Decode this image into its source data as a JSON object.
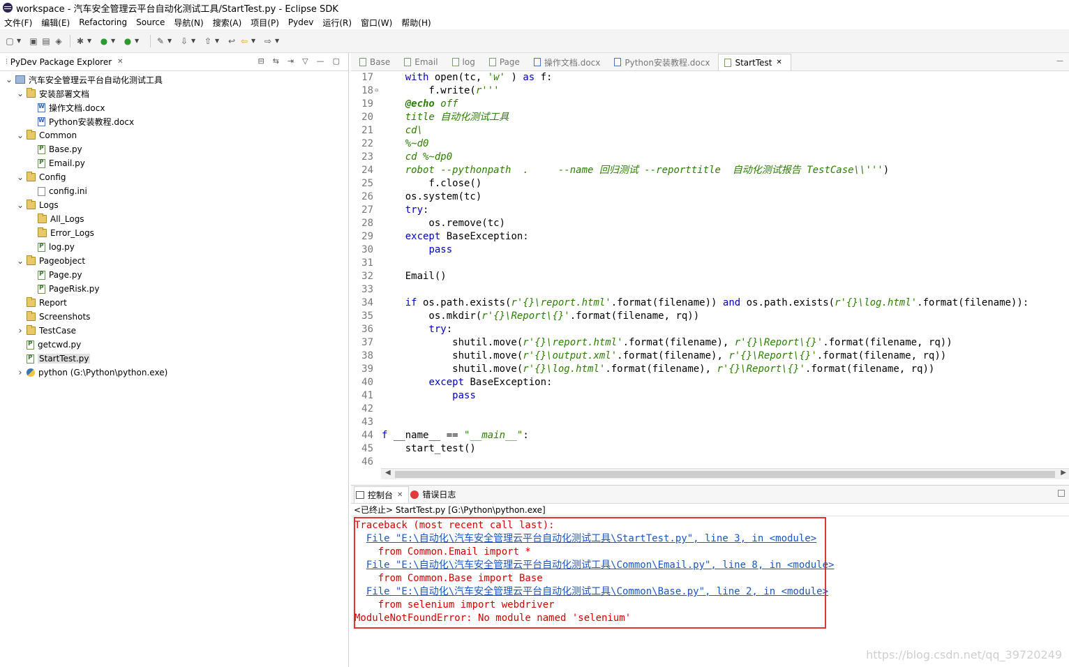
{
  "window": {
    "title": "workspace - 汽车安全管理云平台自动化测试工具/StartTest.py - Eclipse SDK"
  },
  "menu": [
    "文件(F)",
    "编辑(E)",
    "Refactoring",
    "Source",
    "导航(N)",
    "搜索(A)",
    "项目(P)",
    "Pydev",
    "运行(R)",
    "窗口(W)",
    "帮助(H)"
  ],
  "explorer": {
    "title": "PyDev Package Explorer",
    "items": [
      {
        "label": "汽车安全管理云平台自动化测试工具",
        "icon": "project",
        "depth": 0,
        "arrow": "v"
      },
      {
        "label": "安装部署文档",
        "icon": "folder",
        "depth": 1,
        "arrow": "v"
      },
      {
        "label": "操作文档.docx",
        "icon": "docx",
        "depth": 2,
        "arrow": ""
      },
      {
        "label": "Python安装教程.docx",
        "icon": "docx",
        "depth": 2,
        "arrow": ""
      },
      {
        "label": "Common",
        "icon": "folder",
        "depth": 1,
        "arrow": "v"
      },
      {
        "label": "Base.py",
        "icon": "py",
        "depth": 2,
        "arrow": ""
      },
      {
        "label": "Email.py",
        "icon": "py",
        "depth": 2,
        "arrow": ""
      },
      {
        "label": "Config",
        "icon": "folder",
        "depth": 1,
        "arrow": "v"
      },
      {
        "label": "config.ini",
        "icon": "ini",
        "depth": 2,
        "arrow": ""
      },
      {
        "label": "Logs",
        "icon": "folder",
        "depth": 1,
        "arrow": "v"
      },
      {
        "label": "All_Logs",
        "icon": "folder",
        "depth": 2,
        "arrow": ""
      },
      {
        "label": "Error_Logs",
        "icon": "folder",
        "depth": 2,
        "arrow": ""
      },
      {
        "label": "log.py",
        "icon": "py",
        "depth": 2,
        "arrow": ""
      },
      {
        "label": "Pageobject",
        "icon": "folder",
        "depth": 1,
        "arrow": "v"
      },
      {
        "label": "Page.py",
        "icon": "py",
        "depth": 2,
        "arrow": ""
      },
      {
        "label": "PageRisk.py",
        "icon": "py",
        "depth": 2,
        "arrow": ""
      },
      {
        "label": "Report",
        "icon": "folder",
        "depth": 1,
        "arrow": ""
      },
      {
        "label": "Screenshots",
        "icon": "folder",
        "depth": 1,
        "arrow": ""
      },
      {
        "label": "TestCase",
        "icon": "folder",
        "depth": 1,
        "arrow": ">"
      },
      {
        "label": "getcwd.py",
        "icon": "py",
        "depth": 1,
        "arrow": ""
      },
      {
        "label": "StartTest.py",
        "icon": "py",
        "depth": 1,
        "arrow": "",
        "selected": true
      },
      {
        "label": "python  (G:\\Python\\python.exe)",
        "icon": "python",
        "depth": 1,
        "arrow": ">"
      }
    ]
  },
  "editor": {
    "tabs": [
      {
        "label": "Base",
        "icon": "py"
      },
      {
        "label": "Email",
        "icon": "py"
      },
      {
        "label": "log",
        "icon": "py"
      },
      {
        "label": "Page",
        "icon": "py"
      },
      {
        "label": "操作文档.docx",
        "icon": "docx"
      },
      {
        "label": "Python安装教程.docx",
        "icon": "docx"
      },
      {
        "label": "StartTest",
        "icon": "py",
        "active": true
      }
    ],
    "lines": [
      {
        "n": "17",
        "segs": [
          [
            "",
            "    "
          ],
          [
            "kw",
            "with"
          ],
          [
            "",
            " open(tc, "
          ],
          [
            "str",
            "'w'"
          ],
          [
            "",
            " ) "
          ],
          [
            "kw",
            "as"
          ],
          [
            "",
            " f:"
          ]
        ]
      },
      {
        "n": "18",
        "fold": true,
        "segs": [
          [
            "",
            "        f.write("
          ],
          [
            "str",
            "r'''"
          ]
        ]
      },
      {
        "n": "19",
        "segs": [
          [
            "",
            "    "
          ],
          [
            "str bold",
            "@echo"
          ],
          [
            "str",
            " off"
          ]
        ]
      },
      {
        "n": "20",
        "segs": [
          [
            "",
            "    "
          ],
          [
            "str",
            "title 自动化测试工具"
          ]
        ]
      },
      {
        "n": "21",
        "segs": [
          [
            "",
            "    "
          ],
          [
            "str",
            "cd\\"
          ]
        ]
      },
      {
        "n": "22",
        "segs": [
          [
            "",
            "    "
          ],
          [
            "str",
            "%~d0"
          ]
        ]
      },
      {
        "n": "23",
        "segs": [
          [
            "",
            "    "
          ],
          [
            "str",
            "cd %~dp0"
          ]
        ]
      },
      {
        "n": "24",
        "segs": [
          [
            "",
            "    "
          ],
          [
            "str",
            "robot --pythonpath  .     --name 回归测试 --reporttitle  自动化测试报告 TestCase\\\\'''"
          ],
          [
            "",
            ")"
          ]
        ]
      },
      {
        "n": "25",
        "segs": [
          [
            "",
            "        f.close()"
          ]
        ]
      },
      {
        "n": "26",
        "segs": [
          [
            "",
            "    os.system(tc)"
          ]
        ]
      },
      {
        "n": "27",
        "segs": [
          [
            "",
            "    "
          ],
          [
            "kw",
            "try"
          ],
          [
            "",
            ":"
          ]
        ]
      },
      {
        "n": "28",
        "segs": [
          [
            "",
            "        os.remove(tc)"
          ]
        ]
      },
      {
        "n": "29",
        "segs": [
          [
            "",
            "    "
          ],
          [
            "kw",
            "except"
          ],
          [
            "",
            " BaseException:"
          ]
        ]
      },
      {
        "n": "30",
        "segs": [
          [
            "",
            "        "
          ],
          [
            "kw",
            "pass"
          ]
        ]
      },
      {
        "n": "31",
        "segs": [
          [
            "",
            ""
          ]
        ]
      },
      {
        "n": "32",
        "segs": [
          [
            "",
            "    Email()"
          ]
        ]
      },
      {
        "n": "33",
        "segs": [
          [
            "",
            ""
          ]
        ]
      },
      {
        "n": "34",
        "segs": [
          [
            "",
            "    "
          ],
          [
            "kw",
            "if"
          ],
          [
            "",
            " os.path.exists("
          ],
          [
            "str",
            "r'{}\\report.html'"
          ],
          [
            "",
            ".format(filename)) "
          ],
          [
            "kw",
            "and"
          ],
          [
            "",
            " os.path.exists("
          ],
          [
            "str",
            "r'{}\\log.html'"
          ],
          [
            "",
            ".format(filename)):"
          ]
        ]
      },
      {
        "n": "35",
        "segs": [
          [
            "",
            "        os.mkdir("
          ],
          [
            "str",
            "r'{}\\Report\\{}'"
          ],
          [
            "",
            ".format(filename, rq))"
          ]
        ]
      },
      {
        "n": "36",
        "segs": [
          [
            "",
            "        "
          ],
          [
            "kw",
            "try"
          ],
          [
            "",
            ":"
          ]
        ]
      },
      {
        "n": "37",
        "segs": [
          [
            "",
            "            shutil.move("
          ],
          [
            "str",
            "r'{}\\report.html'"
          ],
          [
            "",
            ".format(filename), "
          ],
          [
            "str",
            "r'{}\\Report\\{}'"
          ],
          [
            "",
            ".format(filename, rq))"
          ]
        ]
      },
      {
        "n": "38",
        "segs": [
          [
            "",
            "            shutil.move("
          ],
          [
            "str",
            "r'{}\\output.xml'"
          ],
          [
            "",
            ".format(filename), "
          ],
          [
            "str",
            "r'{}\\Report\\{}'"
          ],
          [
            "",
            ".format(filename, rq))"
          ]
        ]
      },
      {
        "n": "39",
        "segs": [
          [
            "",
            "            shutil.move("
          ],
          [
            "str",
            "r'{}\\log.html'"
          ],
          [
            "",
            ".format(filename), "
          ],
          [
            "str",
            "r'{}\\Report\\{}'"
          ],
          [
            "",
            ".format(filename, rq))"
          ]
        ]
      },
      {
        "n": "40",
        "segs": [
          [
            "",
            "        "
          ],
          [
            "kw",
            "except"
          ],
          [
            "",
            " BaseException:"
          ]
        ]
      },
      {
        "n": "41",
        "segs": [
          [
            "",
            "            "
          ],
          [
            "kw",
            "pass"
          ]
        ]
      },
      {
        "n": "42",
        "segs": [
          [
            "",
            ""
          ]
        ]
      },
      {
        "n": "43",
        "segs": [
          [
            "",
            ""
          ]
        ]
      },
      {
        "n": "44",
        "segs": [
          [
            "kw",
            "f"
          ],
          [
            "",
            " __name__ == "
          ],
          [
            "str",
            "\"__main__\""
          ],
          [
            "",
            ":"
          ]
        ]
      },
      {
        "n": "45",
        "segs": [
          [
            "",
            "    start_test()"
          ]
        ]
      },
      {
        "n": "46",
        "segs": [
          [
            "",
            ""
          ]
        ]
      }
    ]
  },
  "console": {
    "tabs": [
      {
        "label": "控制台",
        "active": true
      },
      {
        "label": "错误日志"
      }
    ],
    "status": "<已终止> StartTest.py [G:\\Python\\python.exe]",
    "lines": [
      {
        "cls": "red",
        "text": "Traceback (most recent call last):"
      },
      {
        "cls": "lnk",
        "indent": "  ",
        "text": "File \"E:\\自动化\\汽车安全管理云平台自动化测试工具\\StartTest.py\", line 3, in <module>"
      },
      {
        "cls": "red",
        "text": "    from Common.Email import *"
      },
      {
        "cls": "lnk",
        "indent": "  ",
        "text": "File \"E:\\自动化\\汽车安全管理云平台自动化测试工具\\Common\\Email.py\", line 8, in <module>"
      },
      {
        "cls": "red",
        "text": "    from Common.Base import Base"
      },
      {
        "cls": "lnk",
        "indent": "  ",
        "text": "File \"E:\\自动化\\汽车安全管理云平台自动化测试工具\\Common\\Base.py\", line 2, in <module>"
      },
      {
        "cls": "red",
        "text": "    from selenium import webdriver"
      },
      {
        "cls": "red",
        "text": "ModuleNotFoundError: No module named 'selenium'"
      }
    ]
  },
  "watermark": "https://blog.csdn.net/qq_39720249",
  "colors": {
    "keyword": "#0000c0",
    "string": "#2a7f00",
    "error": "#d40000",
    "link": "#1a55c6",
    "highlight_box": "#e53333"
  }
}
